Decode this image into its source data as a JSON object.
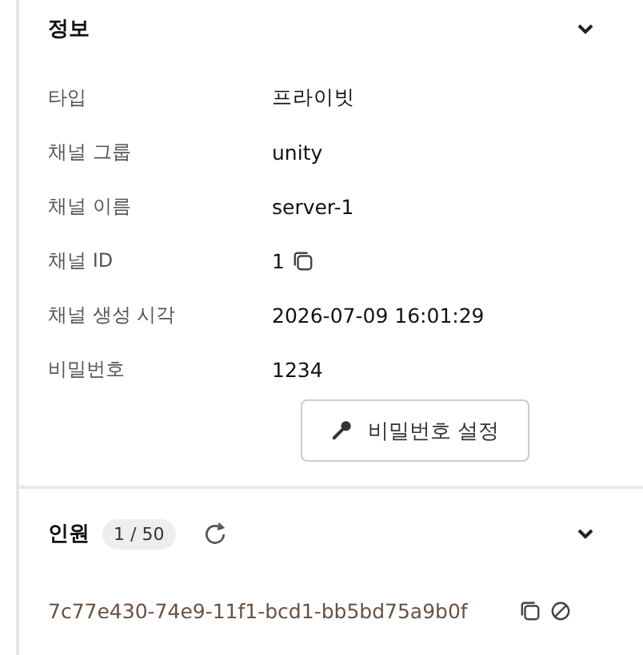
{
  "info": {
    "title": "정보",
    "expanded": true,
    "fields": [
      {
        "label": "타입",
        "value": "프라이빗",
        "kind": "text"
      },
      {
        "label": "채널 그룹",
        "value": "unity",
        "kind": "text"
      },
      {
        "label": "채널 이름",
        "value": "server-1",
        "kind": "text"
      },
      {
        "label": "채널 ID",
        "value": "1",
        "kind": "copy"
      },
      {
        "label": "채널 생성 시각",
        "value": "2026-07-09 16:01:29",
        "kind": "text"
      },
      {
        "label": "비밀번호",
        "value": "1234",
        "kind": "text"
      }
    ],
    "button": "비밀번호 설정"
  },
  "members": {
    "title": "인원",
    "count": "1 / 50",
    "expanded": true,
    "items": [
      {
        "id": "7c77e430-74e9-11f1-bcd1-bb5bd75a9b0f"
      }
    ]
  }
}
